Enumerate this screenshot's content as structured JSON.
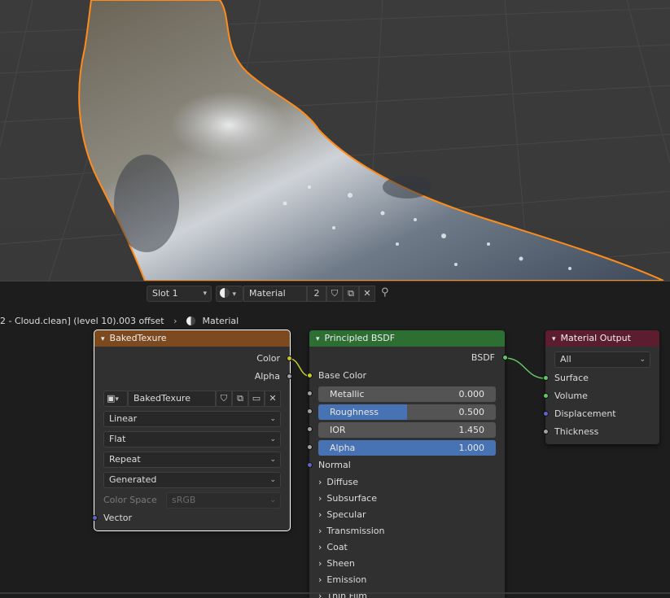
{
  "header": {
    "slot": "Slot 1",
    "material_name": "Material",
    "user_count": "2"
  },
  "breadcrumb": {
    "object_path": "2 - Cloud.clean] (level 10).003 offset",
    "separator": "›",
    "material": "Material"
  },
  "image_node": {
    "title": "BakedTexure",
    "out_color": "Color",
    "out_alpha": "Alpha",
    "image_name": "BakedTexure",
    "interpolation": "Linear",
    "projection": "Flat",
    "extension": "Repeat",
    "source": "Generated",
    "color_space_label": "Color Space",
    "color_space_value": "sRGB",
    "in_vector": "Vector"
  },
  "bsdf_node": {
    "title": "Principled BSDF",
    "out_bsdf": "BSDF",
    "base_color": "Base Color",
    "metallic": {
      "label": "Metallic",
      "value": "0.000",
      "fraction": 0.0
    },
    "roughness": {
      "label": "Roughness",
      "value": "0.500",
      "fraction": 0.5
    },
    "ior": {
      "label": "IOR",
      "value": "1.450",
      "fraction": 0.0
    },
    "alpha": {
      "label": "Alpha",
      "value": "1.000",
      "fraction": 1.0
    },
    "normal": "Normal",
    "panels": [
      "Diffuse",
      "Subsurface",
      "Specular",
      "Transmission",
      "Coat",
      "Sheen",
      "Emission",
      "Thin Film"
    ]
  },
  "output_node": {
    "title": "Material Output",
    "target": "All",
    "in_surface": "Surface",
    "in_volume": "Volume",
    "in_displacement": "Displacement",
    "in_thickness": "Thickness"
  },
  "colors": {
    "image_header": "#7d4a1f",
    "bsdf_header": "#2d6e33",
    "output_header": "#5c1e2e",
    "socket_color": "#c7c729",
    "socket_gray": "#a1a1a1",
    "socket_vector": "#6363c7",
    "socket_shader": "#63c763",
    "selection_outline": "#ff8c1a",
    "slider_fill": "#4772b3"
  }
}
